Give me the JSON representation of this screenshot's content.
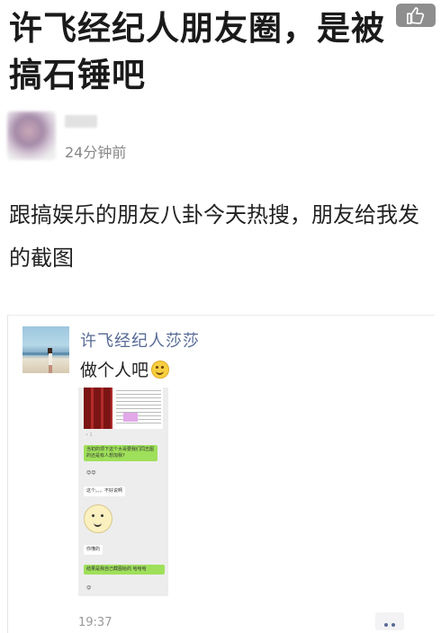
{
  "article": {
    "title": "许飞经纪人朋友圈，是被搞石锤吧",
    "time": "24分钟前",
    "body": "跟搞娱乐的朋友八卦今天热搜，朋友给我发的截图"
  },
  "moment": {
    "name": "许飞经纪人莎莎",
    "text": "做个人吧",
    "time": "19:37",
    "chat": {
      "bubble1": "当初的项下这个大哥要我们同志图的还是有人想加我?",
      "bubble2": "这个。。。不好说啊",
      "bubble3": "你懂的",
      "bubble4": "结果是我自己截图给的 哈哈哈"
    }
  },
  "icons": {
    "like": "thumbs-up-icon",
    "more": "more-dots-icon",
    "emoji": "smiley-emoji-icon"
  },
  "colors": {
    "link_blue": "#576b95",
    "wechat_green": "#9fe05a",
    "like_bg": "#8e8e8e"
  }
}
